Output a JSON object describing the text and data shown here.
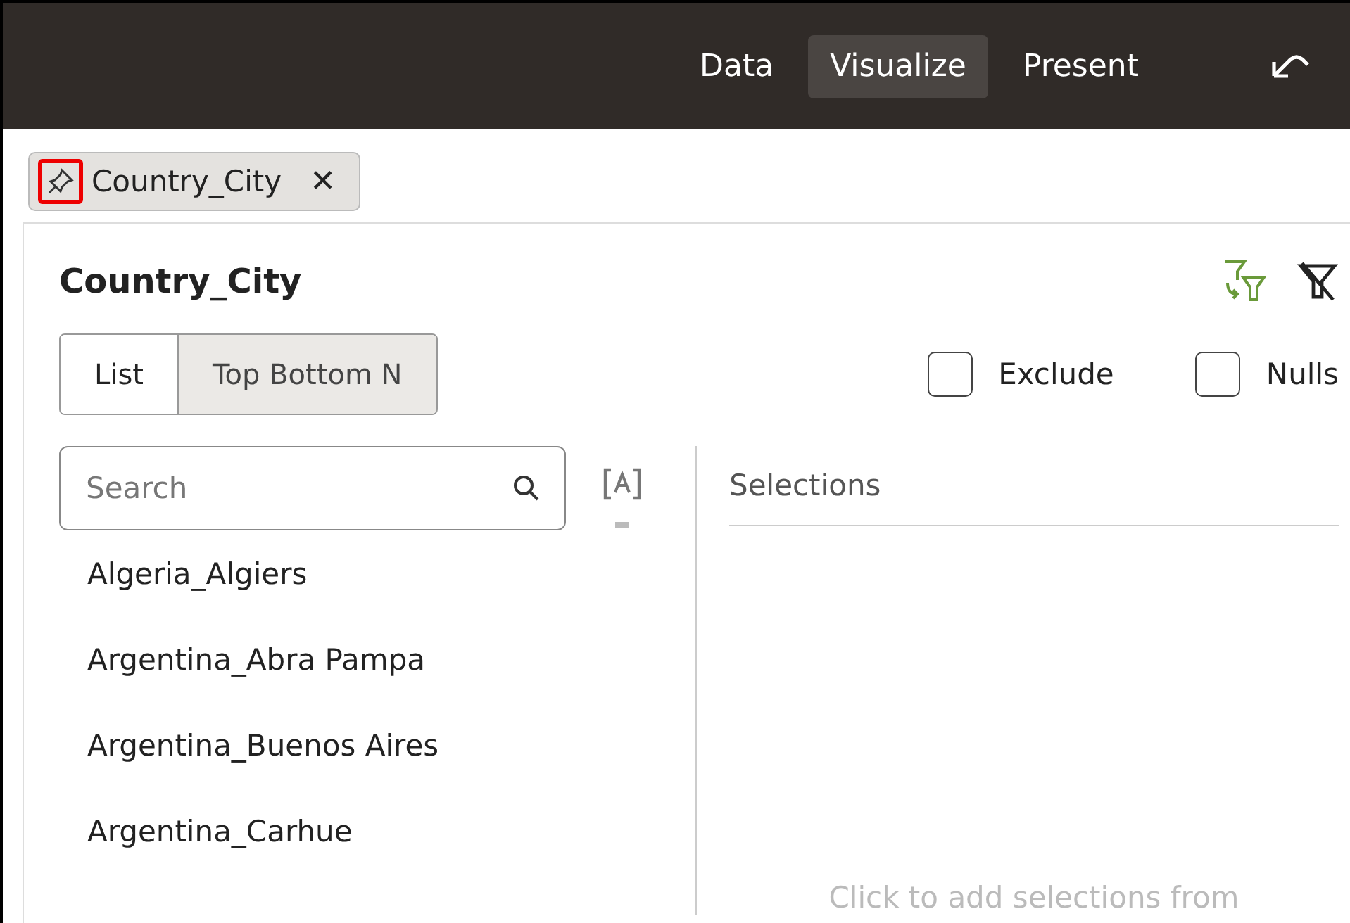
{
  "top_bar": {
    "tabs": [
      {
        "label": "Data",
        "selected": false
      },
      {
        "label": "Visualize",
        "selected": true
      },
      {
        "label": "Present",
        "selected": false
      }
    ]
  },
  "filter_pill": {
    "label": "Country_City",
    "close": "✕",
    "pin_highlighted": true
  },
  "panel": {
    "title": "Country_City",
    "modes": [
      {
        "label": "List",
        "selected": true
      },
      {
        "label": "Top Bottom N",
        "selected": false
      }
    ],
    "options": [
      {
        "label": "Exclude",
        "checked": false
      },
      {
        "label": "Nulls",
        "checked": false
      }
    ],
    "search": {
      "placeholder": "Search"
    },
    "values": [
      "Algeria_Algiers",
      "Argentina_Abra Pampa",
      "Argentina_Buenos Aires",
      "Argentina_Carhue"
    ],
    "selections": {
      "heading": "Selections",
      "hint": "Click to add selections from"
    }
  }
}
